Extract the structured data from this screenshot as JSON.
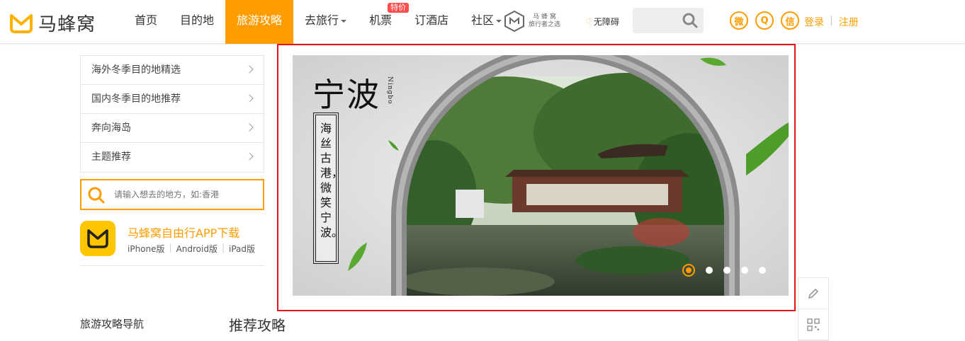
{
  "brand": {
    "name": "马蜂窝",
    "color": "#ff9d00"
  },
  "nav": {
    "items": [
      {
        "label": "首页",
        "active": false,
        "dropdown": false
      },
      {
        "label": "目的地",
        "active": false,
        "dropdown": false
      },
      {
        "label": "旅游攻略",
        "active": true,
        "dropdown": false
      },
      {
        "label": "去旅行",
        "active": false,
        "dropdown": true
      },
      {
        "label": "机票",
        "active": false,
        "dropdown": false,
        "badge": "特价"
      },
      {
        "label": "订酒店",
        "active": false,
        "dropdown": false
      },
      {
        "label": "社区",
        "active": false,
        "dropdown": true
      }
    ],
    "partner": {
      "name": "马 蜂 窝",
      "tagline": "旅行者之选"
    },
    "accessibility": "无障碍",
    "social": [
      {
        "icon": "weibo-icon",
        "glyph": "微"
      },
      {
        "icon": "qq-icon",
        "glyph": "Q"
      },
      {
        "icon": "wechat-icon",
        "glyph": "信"
      }
    ],
    "login": "登录",
    "register": "注册"
  },
  "sidebar": {
    "items": [
      {
        "label": "海外冬季目的地精选"
      },
      {
        "label": "国内冬季目的地推荐"
      },
      {
        "label": "奔向海岛"
      },
      {
        "label": "主题推荐"
      }
    ],
    "search": {
      "placeholder": "请输入想去的地方，如:香港"
    },
    "app": {
      "title": "马蜂窝自由行APP下载",
      "links": [
        "iPhone版",
        "Android版",
        "iPad版"
      ]
    }
  },
  "banner": {
    "title": "宁波",
    "roman": "Ningbo",
    "poem": "海丝古港，微笑宁波。",
    "slides_total": 5,
    "active_slide": 1
  },
  "sections": {
    "guide_nav": "旅游攻略导航",
    "recommended": "推荐攻略"
  }
}
